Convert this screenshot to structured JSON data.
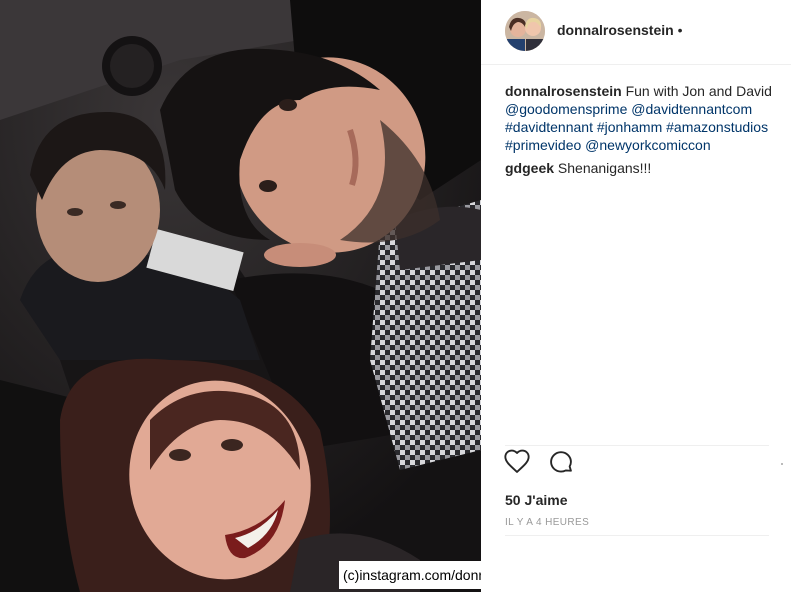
{
  "photo": {
    "alt": "Selfie of three people in a dark car",
    "credit": "(c)instagram.com/donnalrosenstein/"
  },
  "post": {
    "username": "donnalrosenstein",
    "header_separator": "•",
    "caption": {
      "user": "donnalrosenstein",
      "text": "Fun with Jon and David",
      "tags": [
        "@goodomensprime",
        "@davidtennantcom",
        "#davidtennant",
        "#jonhamm",
        "#amazonstudios",
        "#primevideo",
        "@newyorkcomiccon"
      ]
    },
    "comments": [
      {
        "user": "gdgeek",
        "text": "Shenanigans!!!"
      }
    ],
    "likes": "50 J'aime",
    "timestamp": "IL Y A 4 HEURES"
  },
  "icons": [
    "heart-icon",
    "comment-icon"
  ],
  "colors": {
    "text": "#262626",
    "link": "#003569",
    "muted": "#999999",
    "divider": "#efefef"
  }
}
